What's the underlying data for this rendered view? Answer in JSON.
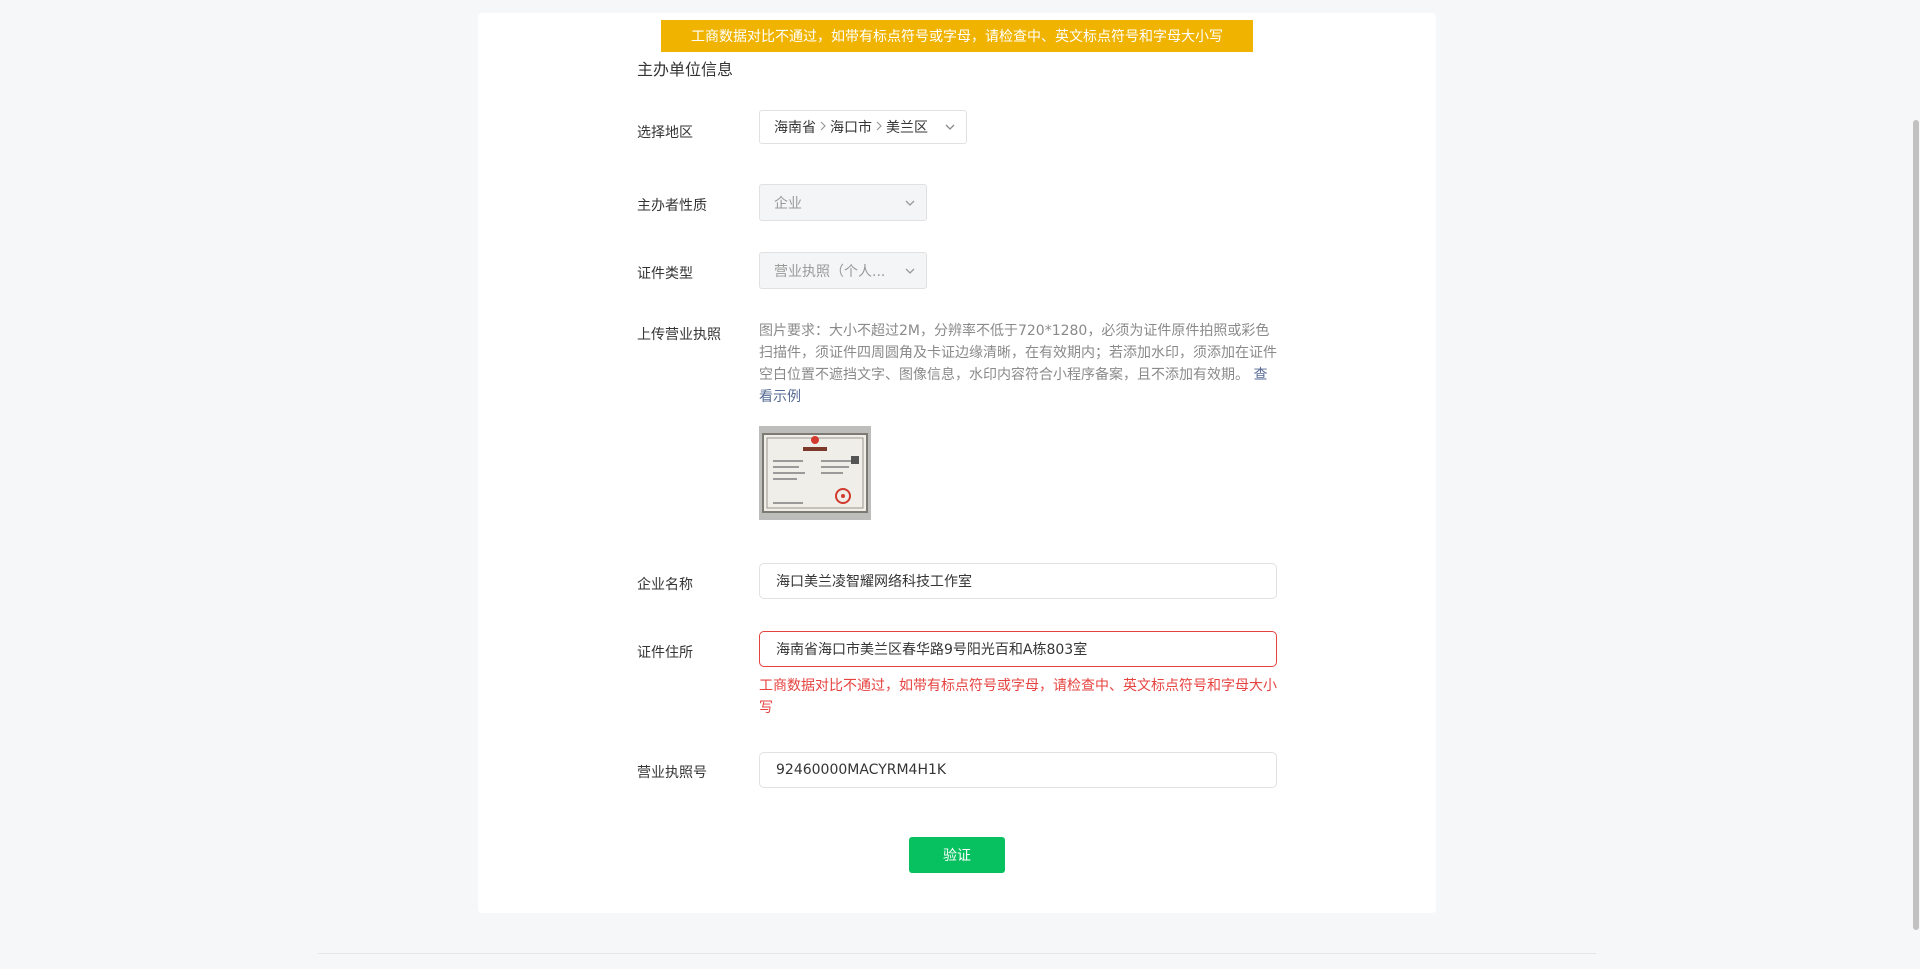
{
  "banner": {
    "message": "工商数据对比不通过，如带有标点符号或字母，请检查中、英文标点符号和字母大小写"
  },
  "section": {
    "title": "主办单位信息"
  },
  "form": {
    "region": {
      "label": "选择地区",
      "province": "海南省",
      "city": "海口市",
      "district": "美兰区"
    },
    "sponsor_type": {
      "label": "主办者性质",
      "value": "企业"
    },
    "cert_type": {
      "label": "证件类型",
      "value": "营业执照（个人..."
    },
    "upload": {
      "label": "上传营业执照",
      "requirements": "图片要求：大小不超过2M，分辨率不低于720*1280，必须为证件原件拍照或彩色扫描件，须证件四周圆角及卡证边缘清晰，在有效期内；若添加水印，须添加在证件空白位置不遮挡文字、图像信息，水印内容符合小程序备案，且不添加有效期。",
      "example_link": "查看示例"
    },
    "company_name": {
      "label": "企业名称",
      "value": "海口美兰凌智耀网络科技工作室"
    },
    "address": {
      "label": "证件住所",
      "value": "海南省海口市美兰区春华路9号阳光百和A栋803室",
      "error": "工商数据对比不通过，如带有标点符号或字母，请检查中、英文标点符号和字母大小写"
    },
    "license_no": {
      "label": "营业执照号",
      "value": "92460000MACYRM4H1K"
    }
  },
  "actions": {
    "verify_label": "验证"
  },
  "colors": {
    "banner_bg": "#f0b400",
    "primary_green": "#07c160",
    "error_red": "#e64340",
    "link_blue": "#576b95"
  },
  "icons": {
    "dropdown": "chevron-down-icon",
    "separator": "chevron-right-icon"
  }
}
